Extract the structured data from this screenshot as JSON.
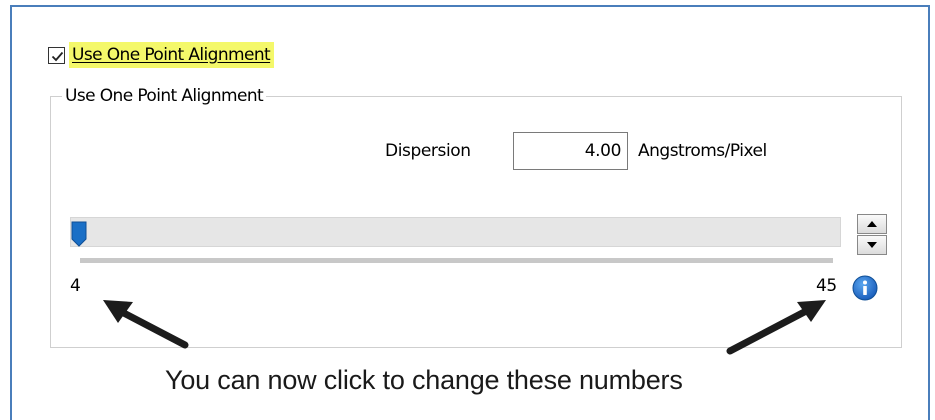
{
  "checkbox": {
    "label": "Use One Point Alignment",
    "checked": true
  },
  "group": {
    "title": "Use One Point Alignment"
  },
  "dispersion": {
    "label": "Dispersion",
    "value": "4.00",
    "unit": "Angstroms/Pixel"
  },
  "slider": {
    "min_label": "4",
    "max_label": "45",
    "value": 4,
    "min": 4,
    "max": 45
  },
  "annotation": {
    "caption": "You can now click to change these numbers"
  },
  "colors": {
    "highlight": "#f4f86a",
    "accent": "#1a6fc6",
    "frame": "#4a7ebb",
    "arrow": "#1c1c1c"
  },
  "icons": {
    "checkbox": "check-icon",
    "info": "info-icon",
    "spin_up": "triangle-up-icon",
    "spin_down": "triangle-down-icon"
  }
}
